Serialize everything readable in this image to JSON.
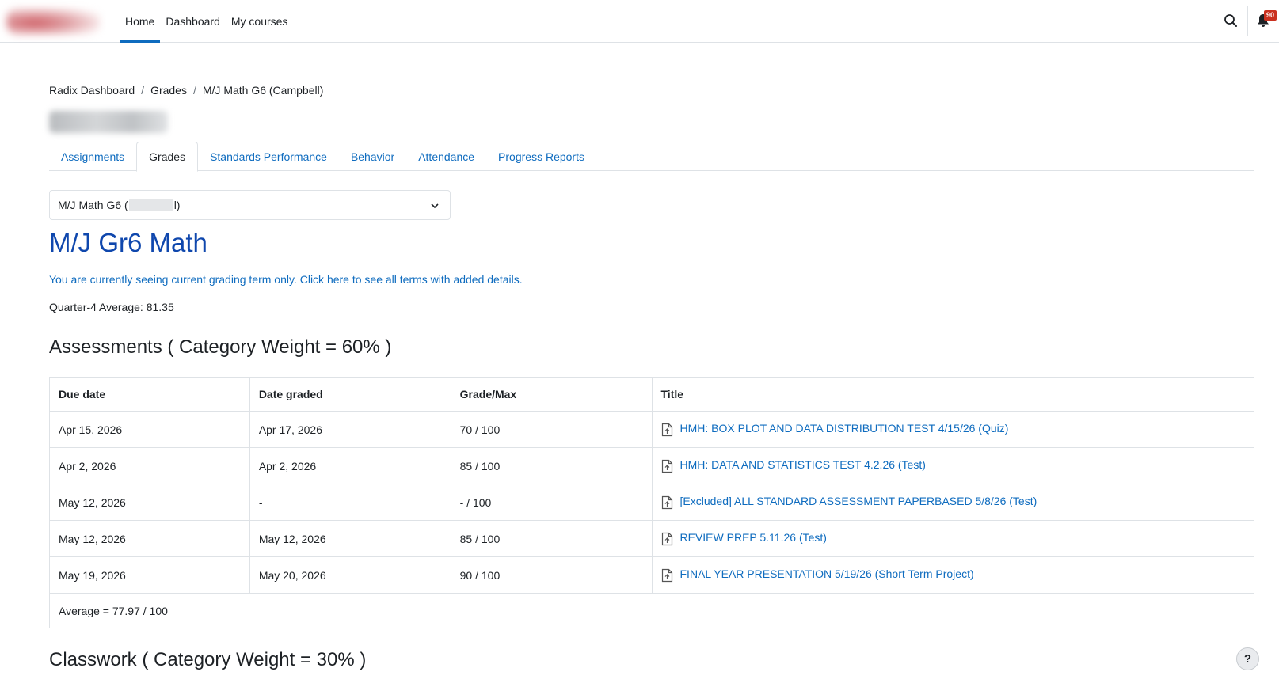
{
  "nav": {
    "items": [
      {
        "label": "Home",
        "active": true
      },
      {
        "label": "Dashboard",
        "active": false
      },
      {
        "label": "My courses",
        "active": false
      }
    ],
    "search_icon": "search-icon",
    "bell_icon": "bell-icon",
    "notification_count": "90",
    "accent_color": "#0f6cbf"
  },
  "breadcrumb": [
    "Radix Dashboard",
    "Grades",
    "M/J Math G6 (Campbell)"
  ],
  "tabs": [
    {
      "label": "Assignments",
      "active": false
    },
    {
      "label": "Grades",
      "active": true
    },
    {
      "label": "Standards Performance",
      "active": false
    },
    {
      "label": "Behavior",
      "active": false
    },
    {
      "label": "Attendance",
      "active": false
    },
    {
      "label": "Progress Reports",
      "active": false
    }
  ],
  "course_select": {
    "prefix": "M/J Math G6 (",
    "suffix": "l)"
  },
  "course": {
    "title": "M/J Gr6 Math",
    "term_notice": "You are currently seeing current grading term only. Click here to see all terms with added details.",
    "quarter_average": "Quarter-4 Average: 81.35"
  },
  "assessments": {
    "heading": "Assessments ( Category Weight = 60% )",
    "columns": [
      "Due date",
      "Date graded",
      "Grade/Max",
      "Title"
    ],
    "rows": [
      {
        "due": "Apr 15, 2026",
        "graded": "Apr 17, 2026",
        "grade": "70 / 100",
        "title": "HMH: BOX PLOT AND DATA DISTRIBUTION TEST 4/15/26 (Quiz)"
      },
      {
        "due": "Apr 2, 2026",
        "graded": "Apr 2, 2026",
        "grade": "85 / 100",
        "title": "HMH: DATA AND STATISTICS TEST 4.2.26 (Test)"
      },
      {
        "due": "May 12, 2026",
        "graded": "-",
        "grade": "- / 100",
        "title": "[Excluded] ALL STANDARD ASSESSMENT PAPERBASED 5/8/26 (Test)"
      },
      {
        "due": "May 12, 2026",
        "graded": "May 12, 2026",
        "grade": "85 / 100",
        "title": "REVIEW PREP 5.11.26 (Test)"
      },
      {
        "due": "May 19, 2026",
        "graded": "May 20, 2026",
        "grade": "90 / 100",
        "title": "FINAL YEAR PRESENTATION 5/19/26 (Short Term Project)"
      }
    ],
    "average": "Average = 77.97 / 100"
  },
  "classwork": {
    "heading": "Classwork ( Category Weight = 30% )"
  },
  "help_label": "?"
}
